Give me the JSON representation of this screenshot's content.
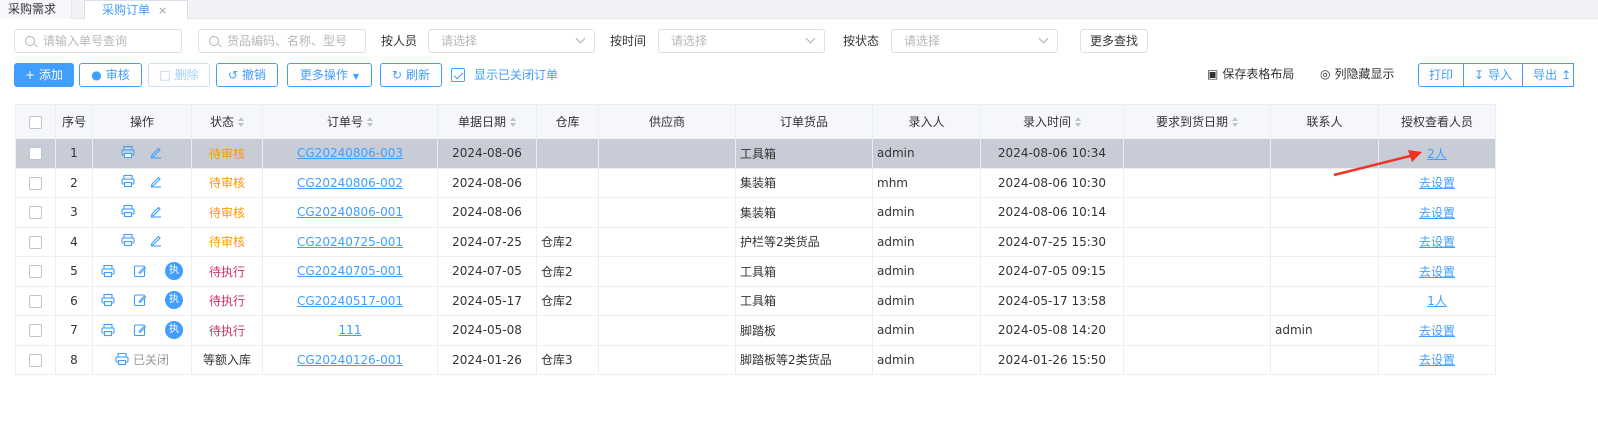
{
  "tabs": [
    {
      "label": "采购需求"
    },
    {
      "label": "采购订单",
      "close": "×"
    }
  ],
  "filters": {
    "order_search_placeholder": "请输入单号查询",
    "goods_search_placeholder": "货品编码、名称、型号",
    "by_person_label": "按人员",
    "by_person_placeholder": "请选择",
    "by_time_label": "按时间",
    "by_time_placeholder": "请选择",
    "by_status_label": "按状态",
    "by_status_placeholder": "请选择",
    "more_search_label": "更多查找"
  },
  "toolbar": {
    "add_label": "添加",
    "review_label": "审核",
    "delete_label": "删除",
    "revoke_label": "撤销",
    "more_ops_label": "更多操作",
    "refresh_label": "刷新",
    "show_closed_label": "显示已关闭订单",
    "show_closed_checked": true,
    "save_layout_label": "保存表格布局",
    "toggle_columns_label": "列隐藏显示",
    "print_label": "打印",
    "import_label": "导入",
    "export_label": "导出"
  },
  "colors": {
    "accent": "#409eff",
    "pending": "#ff9900",
    "executing": "#d0306a",
    "highlight_row": "#c8ccd6",
    "arrow": "#ee3322"
  },
  "table": {
    "headers": {
      "seq": "序号",
      "ops": "操作",
      "status": "状态",
      "order_no": "订单号",
      "doc_date": "单据日期",
      "warehouse": "仓库",
      "supplier": "供应商",
      "goods": "订单货品",
      "entered_by": "录入人",
      "entered_at": "录入时间",
      "required_date": "要求到货日期",
      "contact": "联系人",
      "viewers": "授权查看人员"
    },
    "rows": [
      {
        "seq": "1",
        "status": "待审核",
        "status_kind": "pending",
        "order_no": "CG20240806-003",
        "doc_date": "2024-08-06",
        "warehouse": "",
        "supplier": "",
        "goods": "工具箱",
        "entered_by": "admin",
        "entered_at": "2024-08-06 10:34",
        "required_date": "",
        "contact": "",
        "viewers": "2人",
        "ops": [
          "print-icon",
          "edit-icon"
        ],
        "highlight": true
      },
      {
        "seq": "2",
        "status": "待审核",
        "status_kind": "pending",
        "order_no": "CG20240806-002",
        "doc_date": "2024-08-06",
        "warehouse": "",
        "supplier": "",
        "goods": "集装箱",
        "entered_by": "mhm",
        "entered_at": "2024-08-06 10:30",
        "required_date": "",
        "contact": "",
        "viewers": "去设置",
        "ops": [
          "print-icon",
          "edit-icon"
        ]
      },
      {
        "seq": "3",
        "status": "待审核",
        "status_kind": "pending",
        "order_no": "CG20240806-001",
        "doc_date": "2024-08-06",
        "warehouse": "",
        "supplier": "",
        "goods": "集装箱",
        "entered_by": "admin",
        "entered_at": "2024-08-06 10:14",
        "required_date": "",
        "contact": "",
        "viewers": "去设置",
        "ops": [
          "print-icon",
          "edit-icon"
        ]
      },
      {
        "seq": "4",
        "status": "待审核",
        "status_kind": "pending",
        "order_no": "CG20240725-001",
        "doc_date": "2024-07-25",
        "warehouse": "仓库2",
        "supplier": "",
        "goods": "护栏等2类货品",
        "entered_by": "admin",
        "entered_at": "2024-07-25 15:30",
        "required_date": "",
        "contact": "",
        "viewers": "去设置",
        "ops": [
          "print-icon",
          "edit-icon"
        ]
      },
      {
        "seq": "5",
        "status": "待执行",
        "status_kind": "executing",
        "order_no": "CG20240705-001",
        "doc_date": "2024-07-05",
        "warehouse": "仓库2",
        "supplier": "",
        "goods": "工具箱",
        "entered_by": "admin",
        "entered_at": "2024-07-05 09:15",
        "required_date": "",
        "contact": "",
        "viewers": "去设置",
        "ops": [
          "print-icon",
          "edit-icon",
          "execute-icon"
        ],
        "exec_label": "执"
      },
      {
        "seq": "6",
        "status": "待执行",
        "status_kind": "executing",
        "order_no": "CG20240517-001",
        "doc_date": "2024-05-17",
        "warehouse": "仓库2",
        "supplier": "",
        "goods": "工具箱",
        "entered_by": "admin",
        "entered_at": "2024-05-17 13:58",
        "required_date": "",
        "contact": "",
        "viewers": "1人",
        "ops": [
          "print-icon",
          "edit-icon",
          "execute-icon"
        ],
        "exec_label": "执"
      },
      {
        "seq": "7",
        "status": "待执行",
        "status_kind": "executing",
        "order_no": "111",
        "doc_date": "2024-05-08",
        "warehouse": "",
        "supplier": "",
        "goods": "脚踏板",
        "entered_by": "admin",
        "entered_at": "2024-05-08 14:20",
        "required_date": "",
        "contact": "admin",
        "viewers": "去设置",
        "ops": [
          "print-icon",
          "edit-icon",
          "execute-icon"
        ],
        "exec_label": "执"
      },
      {
        "seq": "8",
        "status": "等额入库",
        "status_kind": "done",
        "order_no": "CG20240126-001",
        "doc_date": "2024-01-26",
        "warehouse": "仓库3",
        "supplier": "",
        "goods": "脚踏板等2类货品",
        "entered_by": "admin",
        "entered_at": "2024-01-26 15:50",
        "required_date": "",
        "contact": "",
        "viewers": "去设置",
        "ops": [
          "print-icon"
        ],
        "closed_label": "已关闭"
      }
    ]
  }
}
